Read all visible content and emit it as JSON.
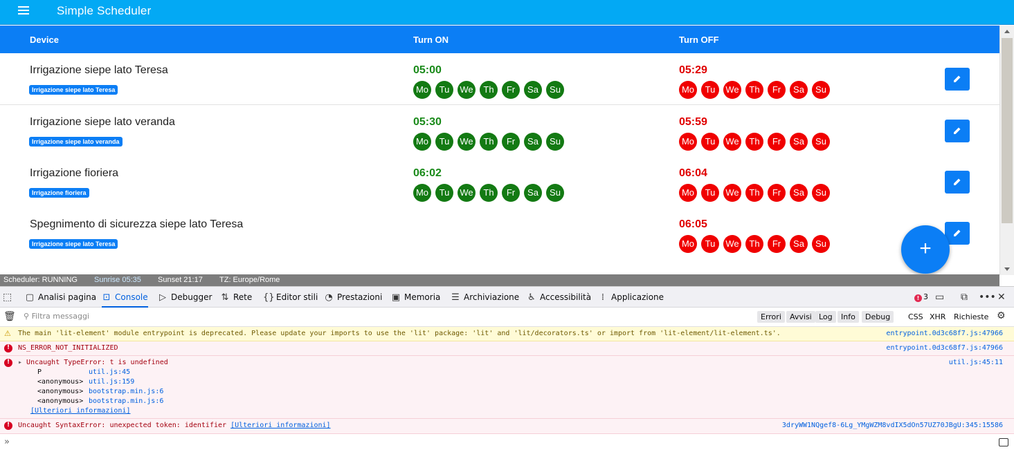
{
  "app": {
    "title": "Simple Scheduler"
  },
  "table": {
    "col_device": "Device",
    "col_on": "Turn ON",
    "col_off": "Turn OFF"
  },
  "rows": [
    {
      "name": "Irrigazione siepe lato Teresa",
      "tag": "Irrigazione siepe lato Teresa",
      "on_time": "05:00",
      "off_time": "05:29",
      "on_days": [
        "Mo",
        "Tu",
        "We",
        "Th",
        "Fr",
        "Sa",
        "Su"
      ],
      "off_days": [
        "Mo",
        "Tu",
        "We",
        "Th",
        "Fr",
        "Sa",
        "Su"
      ]
    },
    {
      "name": "Irrigazione siepe lato veranda",
      "tag": "Irrigazione siepe lato veranda",
      "on_time": "05:30",
      "off_time": "05:59",
      "on_days": [
        "Mo",
        "Tu",
        "We",
        "Th",
        "Fr",
        "Sa",
        "Su"
      ],
      "off_days": [
        "Mo",
        "Tu",
        "We",
        "Th",
        "Fr",
        "Sa",
        "Su"
      ]
    },
    {
      "name": "Irrigazione fioriera",
      "tag": "Irrigazione fioriera",
      "on_time": "06:02",
      "off_time": "06:04",
      "on_days": [
        "Mo",
        "Tu",
        "We",
        "Th",
        "Fr",
        "Sa",
        "Su"
      ],
      "off_days": [
        "Mo",
        "Tu",
        "We",
        "Th",
        "Fr",
        "Sa",
        "Su"
      ]
    },
    {
      "name": "Spegnimento di sicurezza siepe lato Teresa",
      "tag": "Irrigazione siepe lato Teresa",
      "on_time": "",
      "off_time": "06:05",
      "on_days": [],
      "off_days": [
        "Mo",
        "Tu",
        "We",
        "Th",
        "Fr",
        "Sa",
        "Su"
      ]
    }
  ],
  "fab": {
    "label": "+"
  },
  "status": {
    "scheduler": "Scheduler: RUNNING",
    "sunrise": "Sunrise 05:35",
    "sunset": "Sunset 21:17",
    "tz": "TZ: Europe/Rome"
  },
  "devtools": {
    "tabs": [
      {
        "label": "Analisi pagina",
        "icon": "inspector-icon"
      },
      {
        "label": "Console",
        "icon": "console-icon"
      },
      {
        "label": "Debugger",
        "icon": "debugger-icon"
      },
      {
        "label": "Rete",
        "icon": "network-icon"
      },
      {
        "label": "Editor stili",
        "icon": "style-editor-icon"
      },
      {
        "label": "Prestazioni",
        "icon": "performance-icon"
      },
      {
        "label": "Memoria",
        "icon": "memory-icon"
      },
      {
        "label": "Archiviazione",
        "icon": "storage-icon"
      },
      {
        "label": "Accessibilità",
        "icon": "accessibility-icon"
      },
      {
        "label": "Applicazione",
        "icon": "application-icon"
      }
    ],
    "active_tab": "Console",
    "error_count": "3",
    "filter_placeholder": "Filtra messaggi",
    "filters": [
      "Errori",
      "Avvisi",
      "Log",
      "Info",
      "Debug"
    ],
    "extra_filters": [
      "CSS",
      "XHR",
      "Richieste"
    ],
    "messages": {
      "warn": {
        "text": "The main 'lit-element' module entrypoint is deprecated. Please update your imports to use the 'lit' package: 'lit' and 'lit/decorators.ts' or import from 'lit-element/lit-element.ts'.",
        "source": "entrypoint.0d3c68f7.js:47966"
      },
      "err1": {
        "text": "NS_ERROR_NOT_INITIALIZED",
        "source": "entrypoint.0d3c68f7.js:47966"
      },
      "err2": {
        "text": "Uncaught TypeError: t is undefined",
        "source": "util.js:45:11",
        "trace": [
          {
            "fn": "P",
            "loc": "util.js:45"
          },
          {
            "fn": "<anonymous>",
            "loc": "util.js:159"
          },
          {
            "fn": "<anonymous>",
            "loc": "bootstrap.min.js:6"
          },
          {
            "fn": "<anonymous>",
            "loc": "bootstrap.min.js:6"
          }
        ],
        "more": "[Ulteriori informazioni]"
      },
      "err3": {
        "text": "Uncaught SyntaxError: unexpected token: identifier",
        "more": "[Ulteriori informazioni]",
        "source": "3dryWW1NQgef8-6Lg_YMgWZM8vdIX5dOn57UZ70JBgU:345:15586"
      }
    },
    "prompt": "»"
  },
  "colors": {
    "header": "#03a9f4",
    "accent": "#0b7ef5",
    "on": "#137a13",
    "off": "#f00000"
  }
}
